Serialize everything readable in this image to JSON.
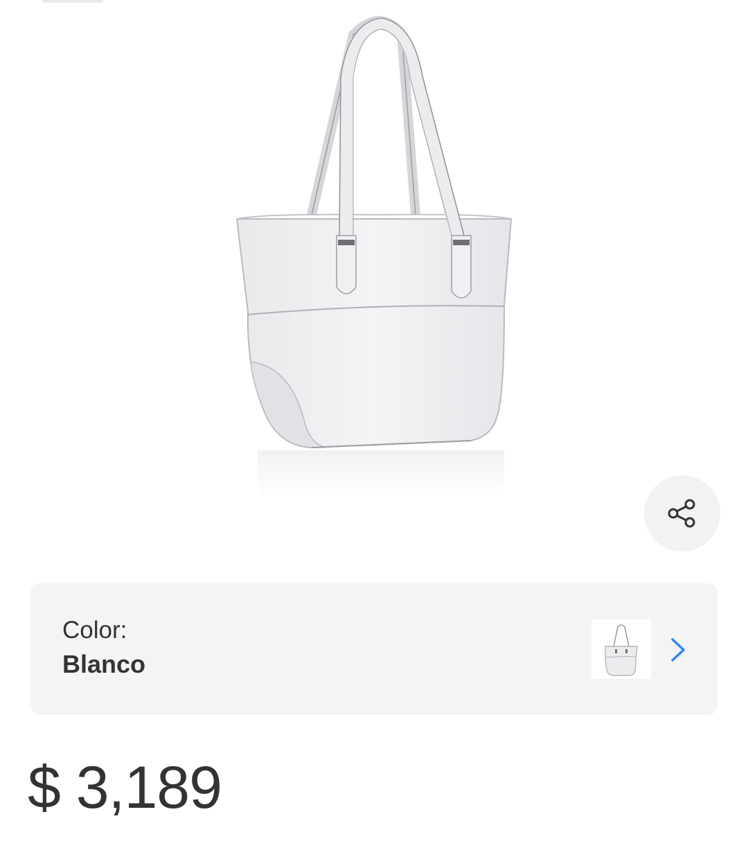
{
  "product": {
    "image_name": "white-tote-bag-image"
  },
  "share": {
    "icon": "share-icon"
  },
  "color_selector": {
    "label": "Color:",
    "value": "Blanco",
    "thumbnail": "white-tote-bag-thumbnail",
    "chevron_icon": "chevron-right-icon",
    "accent_color": "#3483fa"
  },
  "price": {
    "text": "$ 3,189"
  }
}
